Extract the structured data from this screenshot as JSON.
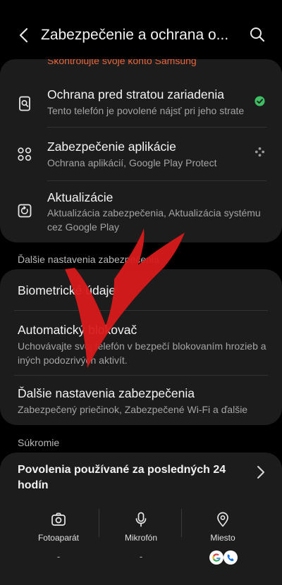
{
  "header": {
    "title": "Zabezpečenie a ochrana o..."
  },
  "top_card": {
    "cut_text": "Skontrolujte svoje konto Samsung",
    "items": [
      {
        "title": "Ochrana pred stratou zariadenia",
        "subtitle": "Tento telefón je povolené nájsť pri jeho strate"
      },
      {
        "title": "Zabezpečenie aplikácie",
        "subtitle": "Ochrana aplikácií, Google Play Protect"
      },
      {
        "title": "Aktualizácie",
        "subtitle": "Aktualizácia zabezpečenia, Aktualizácia systému cez Google Play"
      }
    ]
  },
  "section_more": "Ďalšie nastavenia zabezpečenia",
  "more_card": {
    "items": [
      {
        "title": "Biometrické údaje",
        "subtitle": ""
      },
      {
        "title": "Automatický blokovač",
        "subtitle": "Uchovávajte svoj telefón v bezpečí blokovaním hrozieb a iných podozrivých aktivít."
      },
      {
        "title": "Ďalšie nastavenia zabezpečenia",
        "subtitle": "Zabezpečený priečinok, Zabezpečené Wi-Fi a ďalšie"
      }
    ]
  },
  "section_privacy": "Súkromie",
  "privacy_card": {
    "title": "Povolenia používané za posledných 24 hodín",
    "permissions": [
      {
        "label": "Fotoaparát",
        "value": "-"
      },
      {
        "label": "Mikrofón",
        "value": "-"
      },
      {
        "label": "Miesto",
        "value": ""
      }
    ]
  },
  "colors": {
    "accent_orange": "#e8663c",
    "check_green": "#3fbf63",
    "annotation_red": "#d81a1a"
  }
}
